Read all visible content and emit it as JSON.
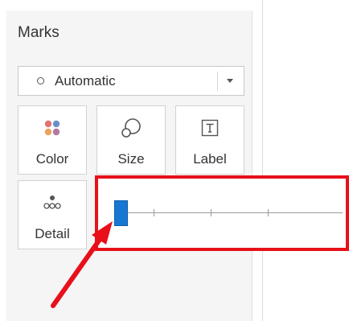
{
  "marks": {
    "title": "Marks",
    "mark_type": {
      "selected": "Automatic"
    },
    "buttons": {
      "color": {
        "label": "Color",
        "icon": "color-dots-icon"
      },
      "size": {
        "label": "Size",
        "icon": "size-shapes-icon"
      },
      "label": {
        "label": "Label",
        "icon": "text-t-icon"
      },
      "detail": {
        "label": "Detail",
        "icon": "detail-dots-icon"
      }
    }
  },
  "size_slider": {
    "value_fraction": 0.0,
    "tick_count": 3
  },
  "annotation": {
    "highlight_color": "#e8101a",
    "arrow_color": "#e8101a"
  },
  "colors": {
    "slider_handle": "#1777d3",
    "panel_bg": "#f5f5f5",
    "color_dots": [
      "#e2726d",
      "#6b8fc7",
      "#e8a35c",
      "#b279a2"
    ]
  }
}
